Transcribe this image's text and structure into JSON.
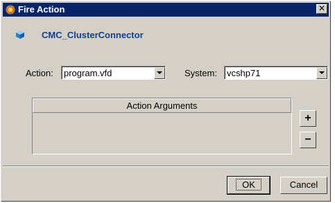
{
  "window": {
    "title": "Fire Action",
    "close_glyph": "✕"
  },
  "header": {
    "title": "CMC_ClusterConnector",
    "icon": "cube-icon"
  },
  "action": {
    "label": "Action:",
    "value": "program.vfd"
  },
  "system": {
    "label": "System:",
    "value": "vcshp71"
  },
  "table": {
    "column_header": "Action Arguments",
    "rows": []
  },
  "side_buttons": {
    "add_label": "+",
    "remove_label": "−"
  },
  "buttons": {
    "ok_label": "OK",
    "cancel_label": "Cancel"
  },
  "colors": {
    "titlebar": "#0a246a",
    "header_text": "#0f3f8f",
    "face": "#d4d0c8"
  }
}
